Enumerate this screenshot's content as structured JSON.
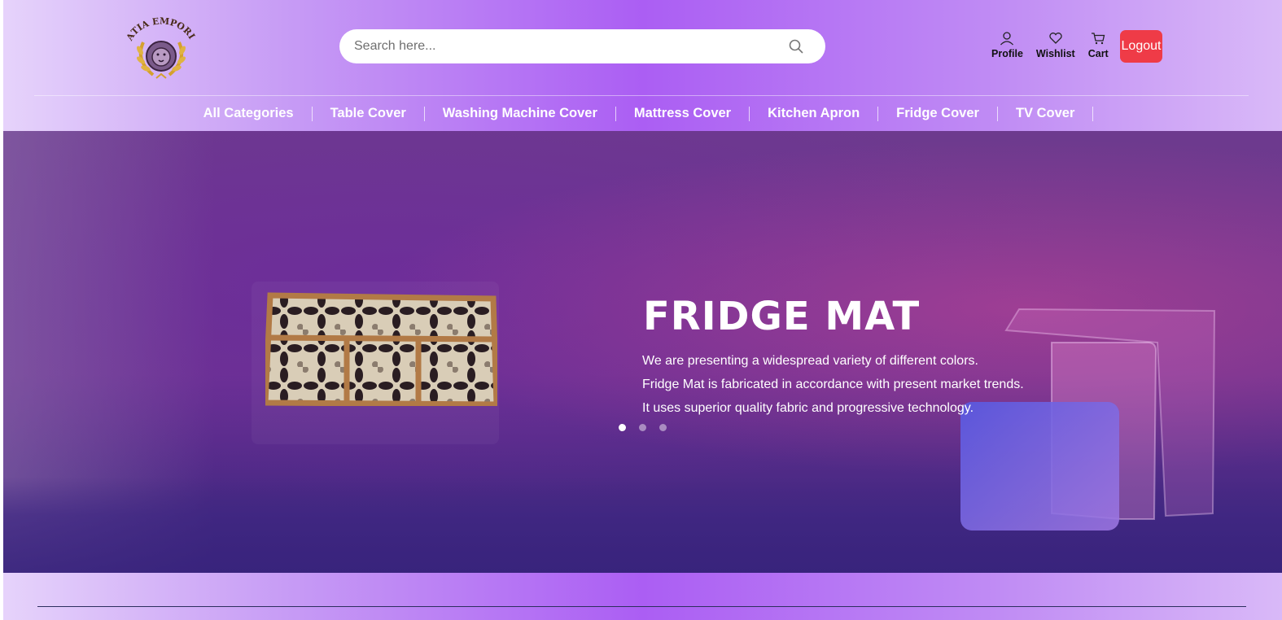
{
  "brand": {
    "name": "BHATIA EMPORIUM",
    "logo_icon": "lion-crest-icon"
  },
  "search": {
    "placeholder": "Search here...",
    "icon": "search-icon"
  },
  "header_actions": [
    {
      "label": "Profile",
      "icon": "user-icon"
    },
    {
      "label": "Wishlist",
      "icon": "heart-icon"
    },
    {
      "label": "Cart",
      "icon": "cart-icon"
    }
  ],
  "logout_label": "Logout",
  "nav": {
    "items": [
      "All Categories",
      "Table Cover",
      "Washing Machine Cover",
      "Mattress Cover",
      "Kitchen Apron",
      "Fridge Cover",
      "TV Cover"
    ]
  },
  "hero": {
    "title": "FRIDGE MAT",
    "lines": [
      "We are presenting a widespread variety of different colors.",
      "Fridge Mat is fabricated in accordance with present market trends.",
      "It uses superior quality fabric and progressive technology."
    ],
    "active_slide": 1,
    "slide_count": 3
  },
  "colors": {
    "header_gradient_center": "#ab5ef3",
    "logout_bg": "#ef3b47",
    "hero_base": "#6b3391"
  }
}
